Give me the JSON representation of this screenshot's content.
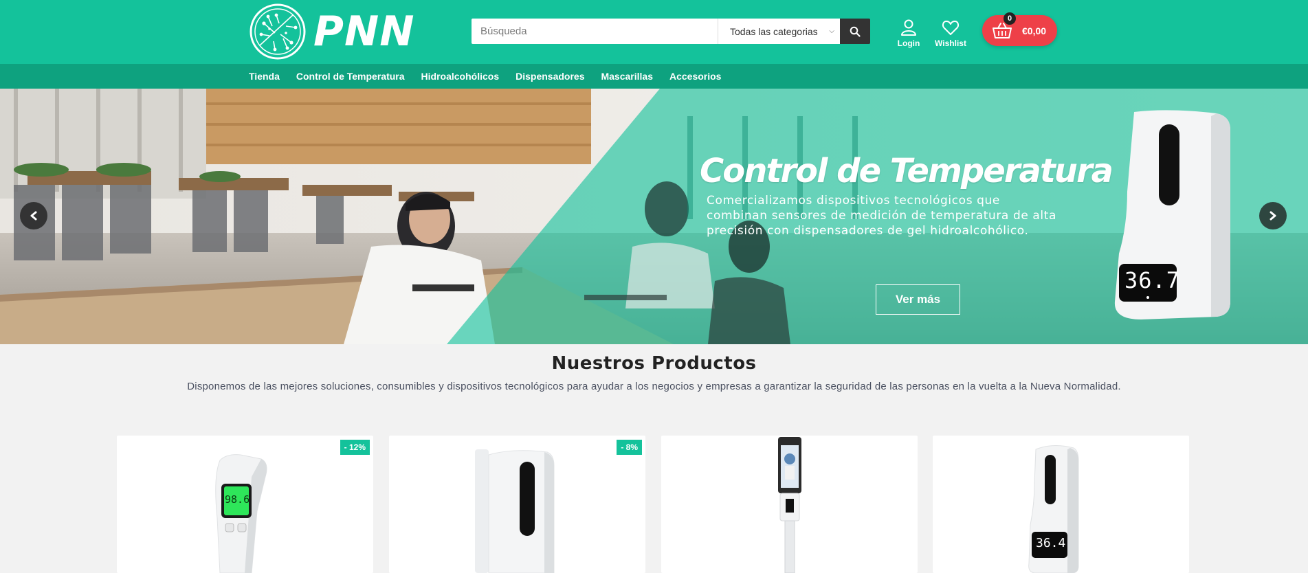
{
  "brand": {
    "name": "PNN",
    "colors": {
      "primary": "#14c29b",
      "nav": "#0ea27f",
      "cart": "#ee4048",
      "dark": "#333333"
    }
  },
  "search": {
    "placeholder": "Búsqueda",
    "category": "Todas las categorias",
    "icon": "search-icon"
  },
  "header_links": {
    "login": "Login",
    "wishlist": "Wishlist"
  },
  "cart": {
    "count": "0",
    "total": "€0,00",
    "icon": "basket-icon"
  },
  "nav": {
    "items": [
      {
        "label": "Tienda"
      },
      {
        "label": "Control de Temperatura"
      },
      {
        "label": "Hidroalcohólicos"
      },
      {
        "label": "Dispensadores"
      },
      {
        "label": "Mascarillas"
      },
      {
        "label": "Accesorios"
      }
    ]
  },
  "hero": {
    "title": "Control de Temperatura",
    "description": "Comercializamos dispositivos tecnológicos que combinan sensores de medición de temperatura de alta precisión con dispensadores de gel hidroalcohólico.",
    "button": "Ver más",
    "device_display": "36.7"
  },
  "products_section": {
    "title": "Nuestros Productos",
    "description": "Disponemos de las mejores soluciones, consumibles y dispositivos tecnológicos para ayudar a los negocios y empresas a garantizar la seguridad de las personas en la vuelta a la Nueva Normalidad."
  },
  "products": [
    {
      "badge": "- 12%",
      "display": "98.6"
    },
    {
      "badge": "- 8%"
    },
    {
      "badge": ""
    },
    {
      "badge": "",
      "display": "36.4"
    }
  ]
}
